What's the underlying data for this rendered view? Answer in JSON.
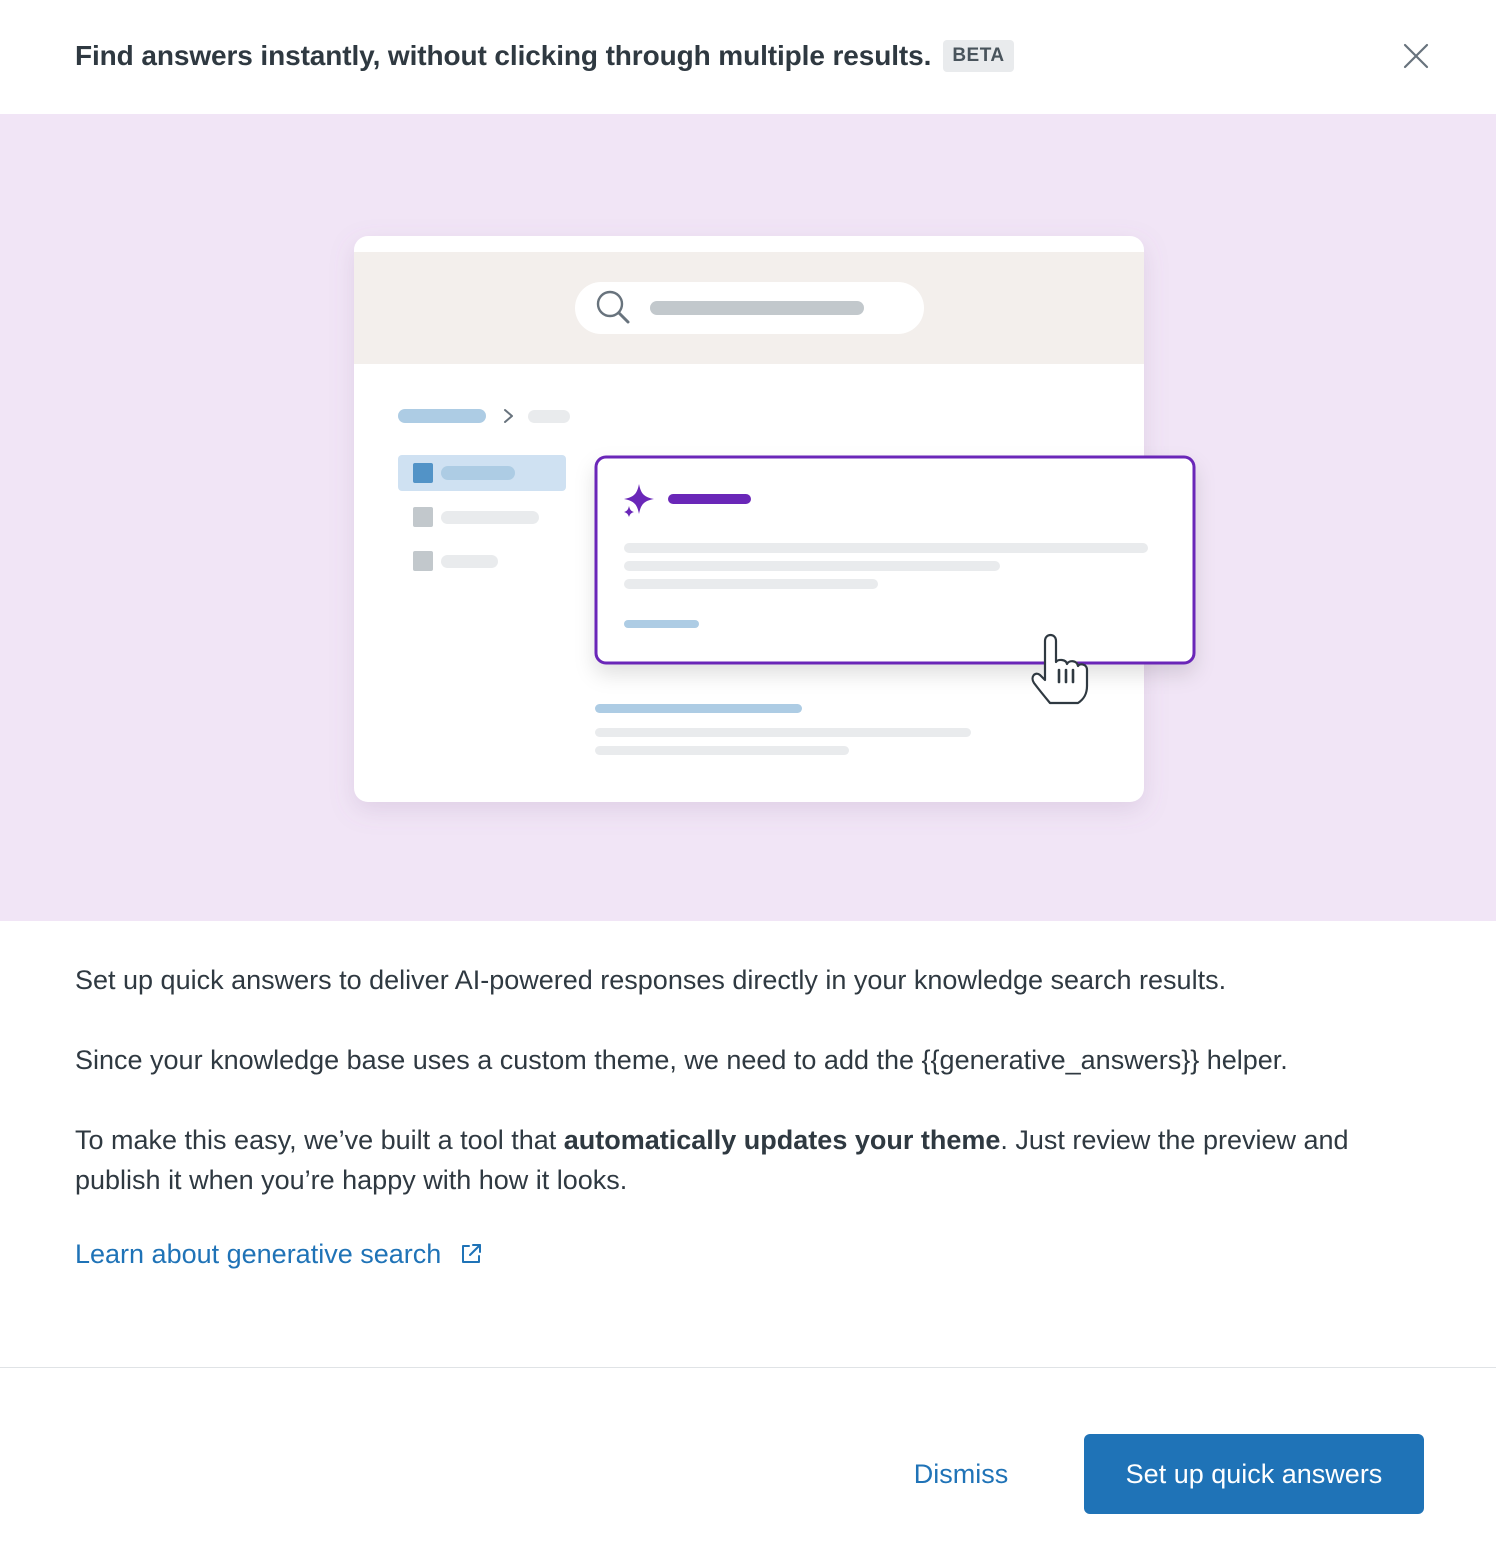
{
  "header": {
    "title": "Find answers instantly, without clicking through multiple results.",
    "badge": "BETA",
    "close_icon": "close-icon"
  },
  "body": {
    "paragraph_1": "Set up quick answers to deliver AI-powered responses directly in your knowledge search results.",
    "paragraph_2": "Since your knowledge base uses a custom theme, we need to add the {{generative_answers}} helper.",
    "paragraph_3_before": "To make this easy, we’ve built a tool that ",
    "paragraph_3_bold": "automatically updates your theme",
    "paragraph_3_after": ". Just review the preview and publish it when you’re happy with how it looks.",
    "link_label": "Learn about generative search",
    "link_icon": "external-link-icon"
  },
  "footer": {
    "dismiss_label": "Dismiss",
    "primary_label": "Set up quick answers"
  },
  "colors": {
    "accent": "#1f73b7",
    "hero_background": "#f1e5f6",
    "ai_purple": "#6a27b8"
  }
}
